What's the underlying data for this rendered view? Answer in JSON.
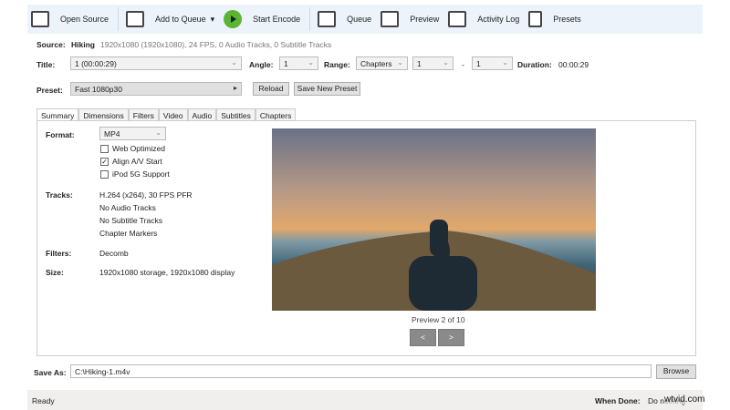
{
  "toolbar": {
    "items": [
      {
        "label": "Open Source",
        "icon": "clapperboard-icon"
      },
      {
        "label": "Add to Queue",
        "icon": "add-queue-icon"
      },
      {
        "label": "Start Encode",
        "icon": "play-icon"
      },
      {
        "label": "Queue",
        "icon": "queue-icon"
      },
      {
        "label": "Preview",
        "icon": "preview-icon"
      },
      {
        "label": "Activity Log",
        "icon": "activity-log-icon"
      },
      {
        "label": "Presets",
        "icon": "presets-icon"
      }
    ]
  },
  "source": {
    "label": "Source:",
    "name": "Hiking",
    "info": "1920x1080 (1920x1080), 24 FPS, 0 Audio Tracks, 0 Subtitle Tracks"
  },
  "title": {
    "label": "Title:",
    "value": "1  (00:00:29)"
  },
  "angle": {
    "label": "Angle:",
    "value": "1"
  },
  "range": {
    "label": "Range:",
    "type": "Chapters",
    "start": "1",
    "dash": "-",
    "end": "1"
  },
  "duration": {
    "label": "Duration:",
    "value": "00:00:29"
  },
  "preset": {
    "label": "Preset:",
    "value": "Fast 1080p30",
    "reload": "Reload",
    "save_new": "Save New Preset"
  },
  "tabs": [
    "Summary",
    "Dimensions",
    "Filters",
    "Video",
    "Audio",
    "Subtitles",
    "Chapters"
  ],
  "summary": {
    "format_label": "Format:",
    "format": "MP4",
    "web_optimized": "Web Optimized",
    "align_av": "Align A/V Start",
    "ipod": "iPod 5G Support",
    "tracks_label": "Tracks:",
    "tracks": [
      "H.264 (x264), 30 FPS PFR",
      "No Audio Tracks",
      "No Subtitle Tracks",
      "Chapter Markers"
    ],
    "filters_label": "Filters:",
    "filters": "Decomb",
    "size_label": "Size:",
    "size": "1920x1080 storage, 1920x1080 display"
  },
  "preview": {
    "caption": "Preview 2 of 10",
    "prev": "<",
    "next": ">"
  },
  "save_as": {
    "label": "Save As:",
    "value": "C:\\Hiking-1.m4v",
    "browse": "Browse"
  },
  "status": {
    "text": "Ready",
    "when_done_label": "When Done:",
    "when_done": "Do nothing",
    "watermark": "wtvid.com"
  }
}
